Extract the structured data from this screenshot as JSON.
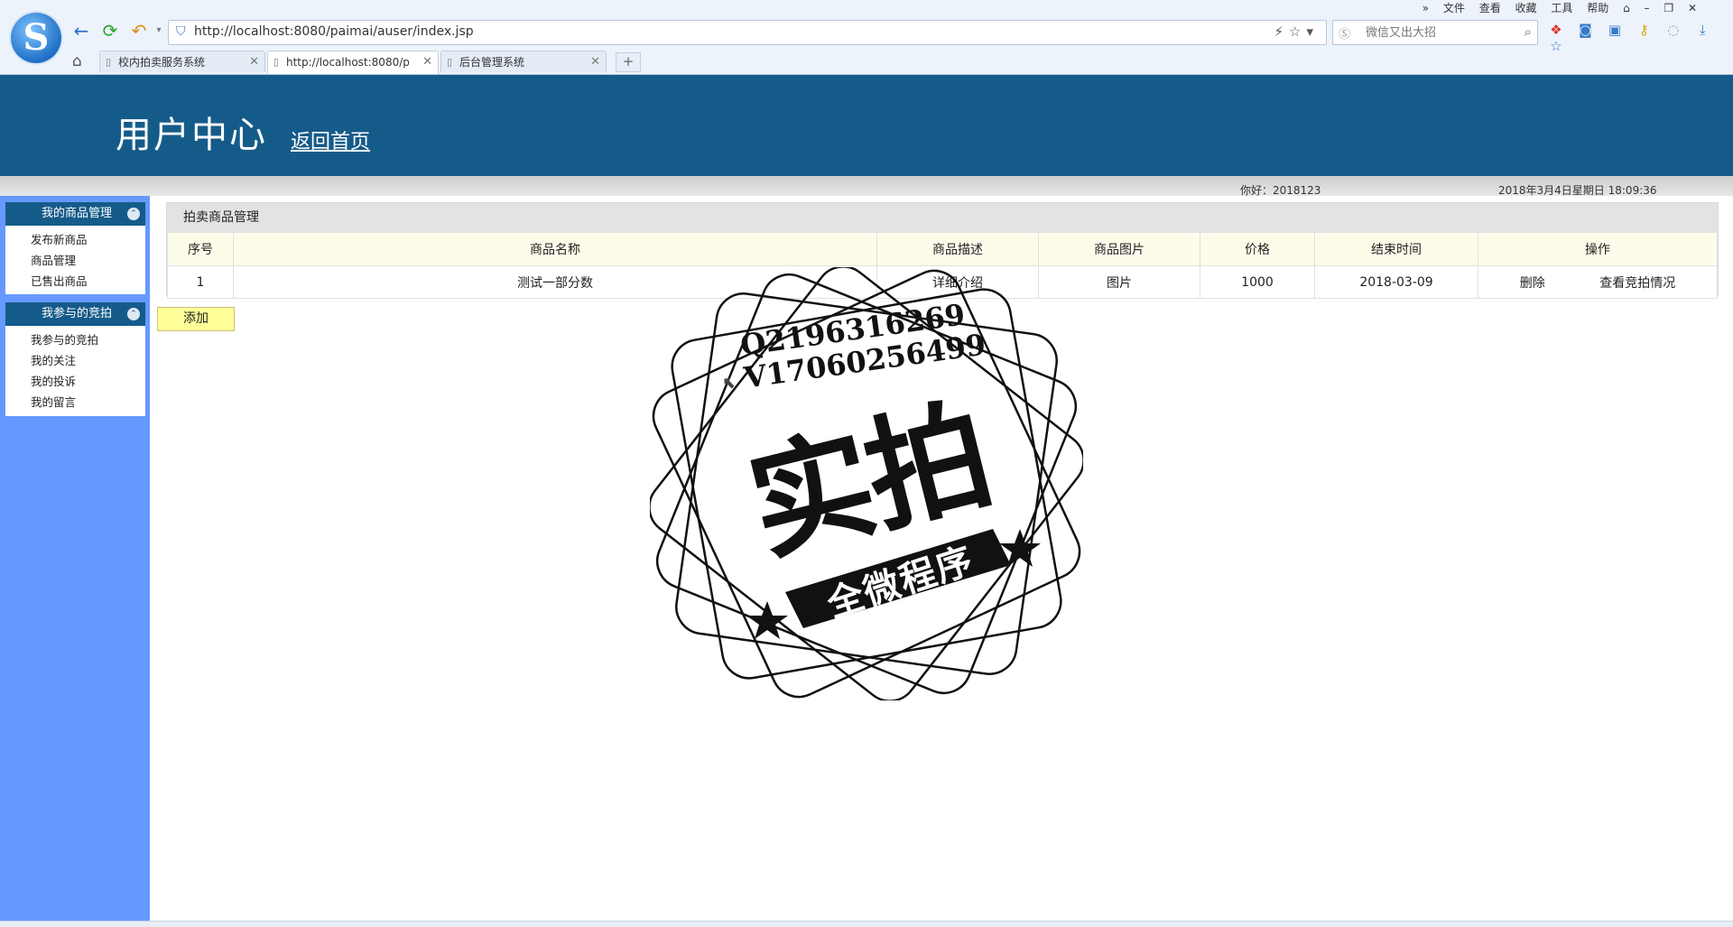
{
  "browser": {
    "url": "http://localhost:8080/paimai/auser/index.jsp",
    "search_placeholder": "微信又出大招",
    "menu": [
      "文件",
      "查看",
      "收藏",
      "工具",
      "帮助"
    ],
    "tabs": [
      {
        "label": "校内拍卖服务系统"
      },
      {
        "label": "http://localhost:8080/p"
      },
      {
        "label": "后台管理系统"
      }
    ],
    "new_tab_label": "+"
  },
  "header": {
    "title": "用户中心",
    "home_link": "返回首页",
    "greeting": "你好：2018123",
    "datetime": "2018年3月4日星期日 18:09:36"
  },
  "sidebar": {
    "groups": [
      {
        "title": "我的商品管理",
        "items": [
          "发布新商品",
          "商品管理",
          "已售出商品"
        ]
      },
      {
        "title": "我参与的竞拍",
        "items": [
          "我参与的竞拍",
          "我的关注",
          "我的投诉",
          "我的留言"
        ]
      }
    ]
  },
  "main": {
    "panel_title": "拍卖商品管理",
    "columns": [
      "序号",
      "商品名称",
      "商品描述",
      "商品图片",
      "价格",
      "结束时间",
      "操作"
    ],
    "rows": [
      {
        "index": "1",
        "name": "测试一部分数",
        "desc": "详细介绍",
        "image": "图片",
        "price": "1000",
        "end": "2018-03-09",
        "delete": "删除",
        "view": "查看竞拍情况"
      }
    ],
    "add_button": "添加"
  },
  "watermark": {
    "line1": "Q2196316269",
    "line2": "V17060256499",
    "main": "实拍",
    "sub": "全微程序"
  }
}
